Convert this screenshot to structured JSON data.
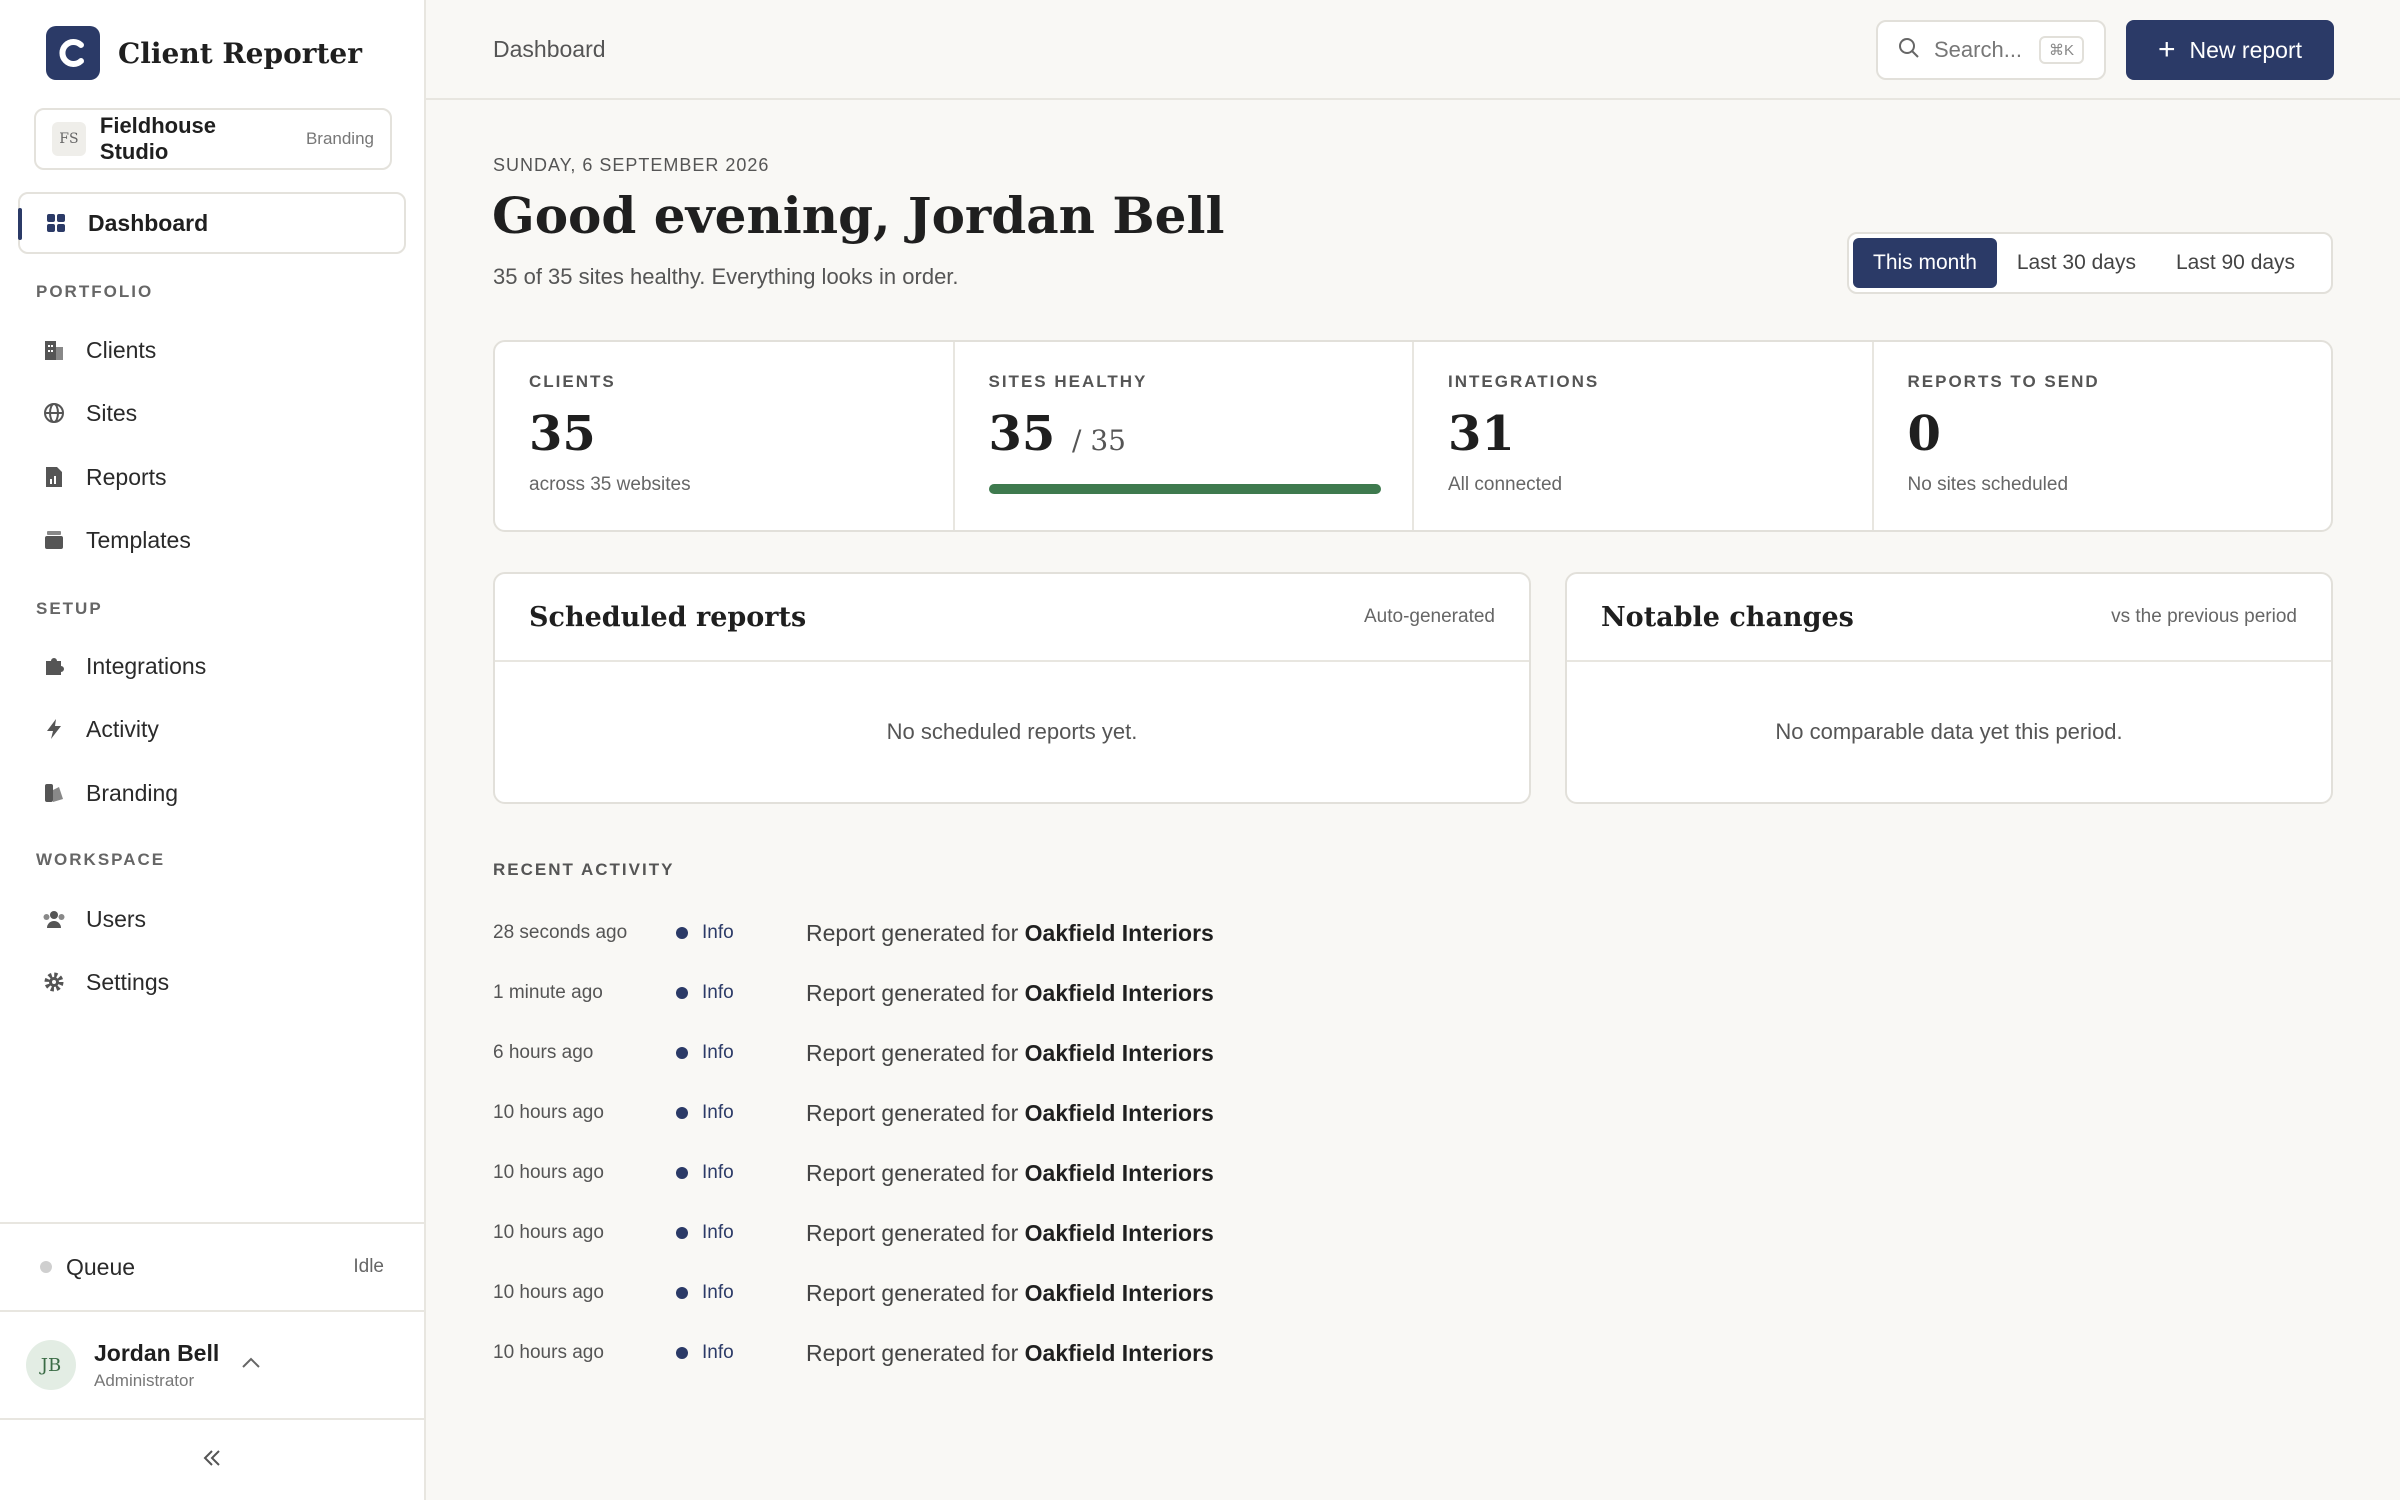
{
  "app": {
    "name": "Client Reporter"
  },
  "org": {
    "initials": "FS",
    "name": "Fieldhouse Studio",
    "tag": "Branding"
  },
  "nav": {
    "dashboard": "Dashboard",
    "sections": {
      "portfolio": "PORTFOLIO",
      "setup": "SETUP",
      "workspace": "WORKSPACE"
    },
    "items": {
      "clients": "Clients",
      "sites": "Sites",
      "reports": "Reports",
      "templates": "Templates",
      "integrations": "Integrations",
      "activity": "Activity",
      "branding": "Branding",
      "users": "Users",
      "settings": "Settings"
    }
  },
  "queue": {
    "label": "Queue",
    "status": "Idle"
  },
  "user": {
    "initials": "JB",
    "name": "Jordan Bell",
    "role": "Administrator"
  },
  "header": {
    "breadcrumb": "Dashboard",
    "search_placeholder": "Search...",
    "search_shortcut": "⌘K",
    "new_report": "New report"
  },
  "main": {
    "date": "SUNDAY, 6 SEPTEMBER 2026",
    "greeting": "Good evening, Jordan Bell",
    "summary": "35 of 35 sites healthy. Everything looks in order.",
    "ranges": [
      "This month",
      "Last 30 days",
      "Last 90 days"
    ],
    "active_range": "This month"
  },
  "stats": {
    "clients": {
      "label": "CLIENTS",
      "value": "35",
      "sub": "across 35 websites"
    },
    "sites": {
      "label": "SITES HEALTHY",
      "value": "35",
      "of": "/ 35",
      "progress": 1.0
    },
    "integrations": {
      "label": "INTEGRATIONS",
      "value": "31",
      "sub": "All connected"
    },
    "reports": {
      "label": "REPORTS TO SEND",
      "value": "0",
      "sub": "No sites scheduled"
    }
  },
  "scheduled": {
    "title": "Scheduled reports",
    "meta": "Auto-generated",
    "empty": "No scheduled reports yet."
  },
  "changes": {
    "title": "Notable changes",
    "meta": "vs the previous period",
    "empty": "No comparable data yet this period."
  },
  "activity": {
    "label": "RECENT ACTIVITY",
    "rows": [
      {
        "time": "28 seconds ago",
        "level": "Info",
        "message": "Report generated for",
        "target": "Oakfield Interiors"
      },
      {
        "time": "1 minute ago",
        "level": "Info",
        "message": "Report generated for",
        "target": "Oakfield Interiors"
      },
      {
        "time": "6 hours ago",
        "level": "Info",
        "message": "Report generated for",
        "target": "Oakfield Interiors"
      },
      {
        "time": "10 hours ago",
        "level": "Info",
        "message": "Report generated for",
        "target": "Oakfield Interiors"
      },
      {
        "time": "10 hours ago",
        "level": "Info",
        "message": "Report generated for",
        "target": "Oakfield Interiors"
      },
      {
        "time": "10 hours ago",
        "level": "Info",
        "message": "Report generated for",
        "target": "Oakfield Interiors"
      },
      {
        "time": "10 hours ago",
        "level": "Info",
        "message": "Report generated for",
        "target": "Oakfield Interiors"
      },
      {
        "time": "10 hours ago",
        "level": "Info",
        "message": "Report generated for",
        "target": "Oakfield Interiors"
      }
    ]
  },
  "colors": {
    "accent": "#2b3a67",
    "success": "#3e7a4e"
  }
}
